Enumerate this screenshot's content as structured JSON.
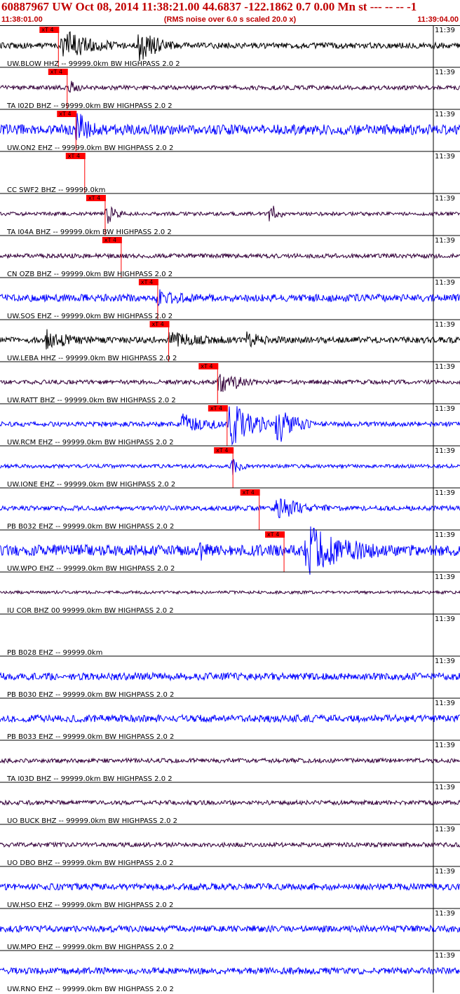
{
  "header": {
    "title": "60887967 UW Oct 08, 2014 11:38:21.00   44.6837 -122.1862  0.7 0.00 Mn st --- -- --  -1",
    "start_time": "11:38:01.00",
    "subtitle": "(RMS noise over 6.0 s scaled 20.0 x)",
    "end_time": "11:39:04.00"
  },
  "colors": {
    "header_red": "#c00000",
    "pick_red": "#ff0000",
    "blue": "#0000ff",
    "black": "#000000",
    "purple": "#33003a"
  },
  "chart_data": {
    "type": "line",
    "time_range": [
      "11:38:01.00",
      "11:39:04.00"
    ],
    "tick_label": "11:39",
    "pick_label": "xT 4",
    "traces": [
      {
        "label": "UW.BLOW HHZ -- 99999.0km BW  HIGHPASS  2.0  2",
        "color": "#000000",
        "pick": 8.0,
        "bursts": [
          [
            8.5,
            0.9,
            3.0
          ],
          [
            19,
            1,
            2.0
          ]
        ],
        "noise": 0.16
      },
      {
        "label": "TA I02D BHZ -- 99999.0km BW  HIGHPASS  2.0  2",
        "color": "#33003a",
        "pick": 9.2,
        "bursts": [
          [
            9.5,
            0.35,
            0.9
          ]
        ],
        "noise": 0.12
      },
      {
        "label": "UW.ON2 EHZ -- 99999.0km BW  HIGHPASS  2.0  2",
        "color": "#0000ff",
        "pick": 10.4,
        "bursts": [
          [
            10.6,
            1,
            1.0
          ]
        ],
        "noise": 0.28
      },
      {
        "label": "CC SWF2 BHZ -- 99999.0km",
        "color": "#000000",
        "pick": 11.6,
        "bursts": [],
        "noise": 0,
        "empty": true
      },
      {
        "label": "TA I04A BHZ -- 99999.0km BW  HIGHPASS  2.0  2",
        "color": "#33003a",
        "pick": 14.4,
        "bursts": [
          [
            14.6,
            0.6,
            1.0
          ],
          [
            37,
            0.6,
            0.8
          ]
        ],
        "noise": 0.1
      },
      {
        "label": "CN OZB BHZ -- 99999.0km BW  HIGHPASS  2.0  2",
        "color": "#33003a",
        "pick": 16.6,
        "bursts": [],
        "noise": 0.12
      },
      {
        "label": "UW.SOS EHZ -- 99999.0km BW  HIGHPASS  2.0  2",
        "color": "#0000ff",
        "pick": 21.6,
        "bursts": [
          [
            21.5,
            0.35,
            2.0
          ]
        ],
        "noise": 0.2
      },
      {
        "label": "UW.LEBA HHZ -- 99999.0km BW  HIGHPASS  2.0  2",
        "color": "#000000",
        "pick": 23.1,
        "bursts": [
          [
            6.3,
            0.45,
            2.5
          ],
          [
            23.2,
            0.35,
            3.0
          ],
          [
            33.8,
            0.3,
            2.0
          ]
        ],
        "noise": 0.17
      },
      {
        "label": "UW.RATT BHZ -- 99999.0km BW  HIGHPASS  2.0  2",
        "color": "#33003a",
        "pick": 29.8,
        "bursts": [
          [
            30.0,
            0.75,
            1.2
          ],
          [
            32.2,
            0.2,
            1.5
          ]
        ],
        "noise": 0.12
      },
      {
        "label": "UW.RCM EHZ -- 99999.0km BW  HIGHPASS  2.0  2",
        "color": "#0000ff",
        "pick": 31.1,
        "bursts": [
          [
            24.8,
            0.5,
            3.0
          ],
          [
            31.5,
            1.2,
            3.0
          ],
          [
            37.9,
            1,
            2.0
          ]
        ],
        "noise": 0.13
      },
      {
        "label": "UW.IONE EHZ -- 99999.0km BW  HIGHPASS  2.0  2",
        "color": "#0000ff",
        "pick": 31.9,
        "bursts": [
          [
            31.7,
            0.5,
            1.0
          ]
        ],
        "noise": 0.1
      },
      {
        "label": "PB B032 EHZ -- 99999.0km BW  HIGHPASS  2.0  2",
        "color": "#0000ff",
        "pick": 35.5,
        "bursts": [
          [
            37.8,
            0.6,
            3.0
          ]
        ],
        "noise": 0.13
      },
      {
        "label": "UW.WPO EHZ -- 99999.0km BW  HIGHPASS  2.0  2",
        "color": "#0000ff",
        "pick": 38.9,
        "bursts": [
          [
            42.0,
            1.2,
            4.0
          ],
          [
            27.5,
            0.3,
            0.6
          ]
        ],
        "noise": 0.3
      },
      {
        "label": "IU COR BHZ 00 99999.0km BW  HIGHPASS  2.0  2",
        "color": "#33003a",
        "pick": null,
        "bursts": [],
        "noise": 0.08
      },
      {
        "label": "PB B028 EHZ -- 99999.0km",
        "color": "#000000",
        "pick": null,
        "bursts": [],
        "noise": 0,
        "empty": true
      },
      {
        "label": "PB B030 EHZ -- 99999.0km BW  HIGHPASS  2.0  2",
        "color": "#0000ff",
        "pick": null,
        "bursts": [],
        "noise": 0.2
      },
      {
        "label": "PB B033 EHZ -- 99999.0km BW  HIGHPASS  2.0  2",
        "color": "#0000ff",
        "pick": null,
        "bursts": [],
        "noise": 0.2
      },
      {
        "label": "TA I03D BHZ -- 99999.0km BW  HIGHPASS  2.0  2",
        "color": "#33003a",
        "pick": null,
        "bursts": [],
        "noise": 0.12
      },
      {
        "label": "UO BUCK BHZ -- 99999.0km BW  HIGHPASS  2.0  2",
        "color": "#33003a",
        "pick": null,
        "bursts": [],
        "noise": 0.12
      },
      {
        "label": "UO DBO BHZ -- 99999.0km BW  HIGHPASS  2.0  2",
        "color": "#33003a",
        "pick": null,
        "bursts": [],
        "noise": 0.12
      },
      {
        "label": "UW.HSO EHZ -- 99999.0km BW  HIGHPASS  2.0  2",
        "color": "#0000ff",
        "pick": null,
        "bursts": [],
        "noise": 0.18
      },
      {
        "label": "UW.MPO EHZ -- 99999.0km BW  HIGHPASS  2.0  2",
        "color": "#0000ff",
        "pick": null,
        "bursts": [],
        "noise": 0.18
      },
      {
        "label": "UW.RNO EHZ -- 99999.0km BW  HIGHPASS  2.0  2",
        "color": "#0000ff",
        "pick": null,
        "bursts": [],
        "noise": 0.18
      }
    ]
  }
}
